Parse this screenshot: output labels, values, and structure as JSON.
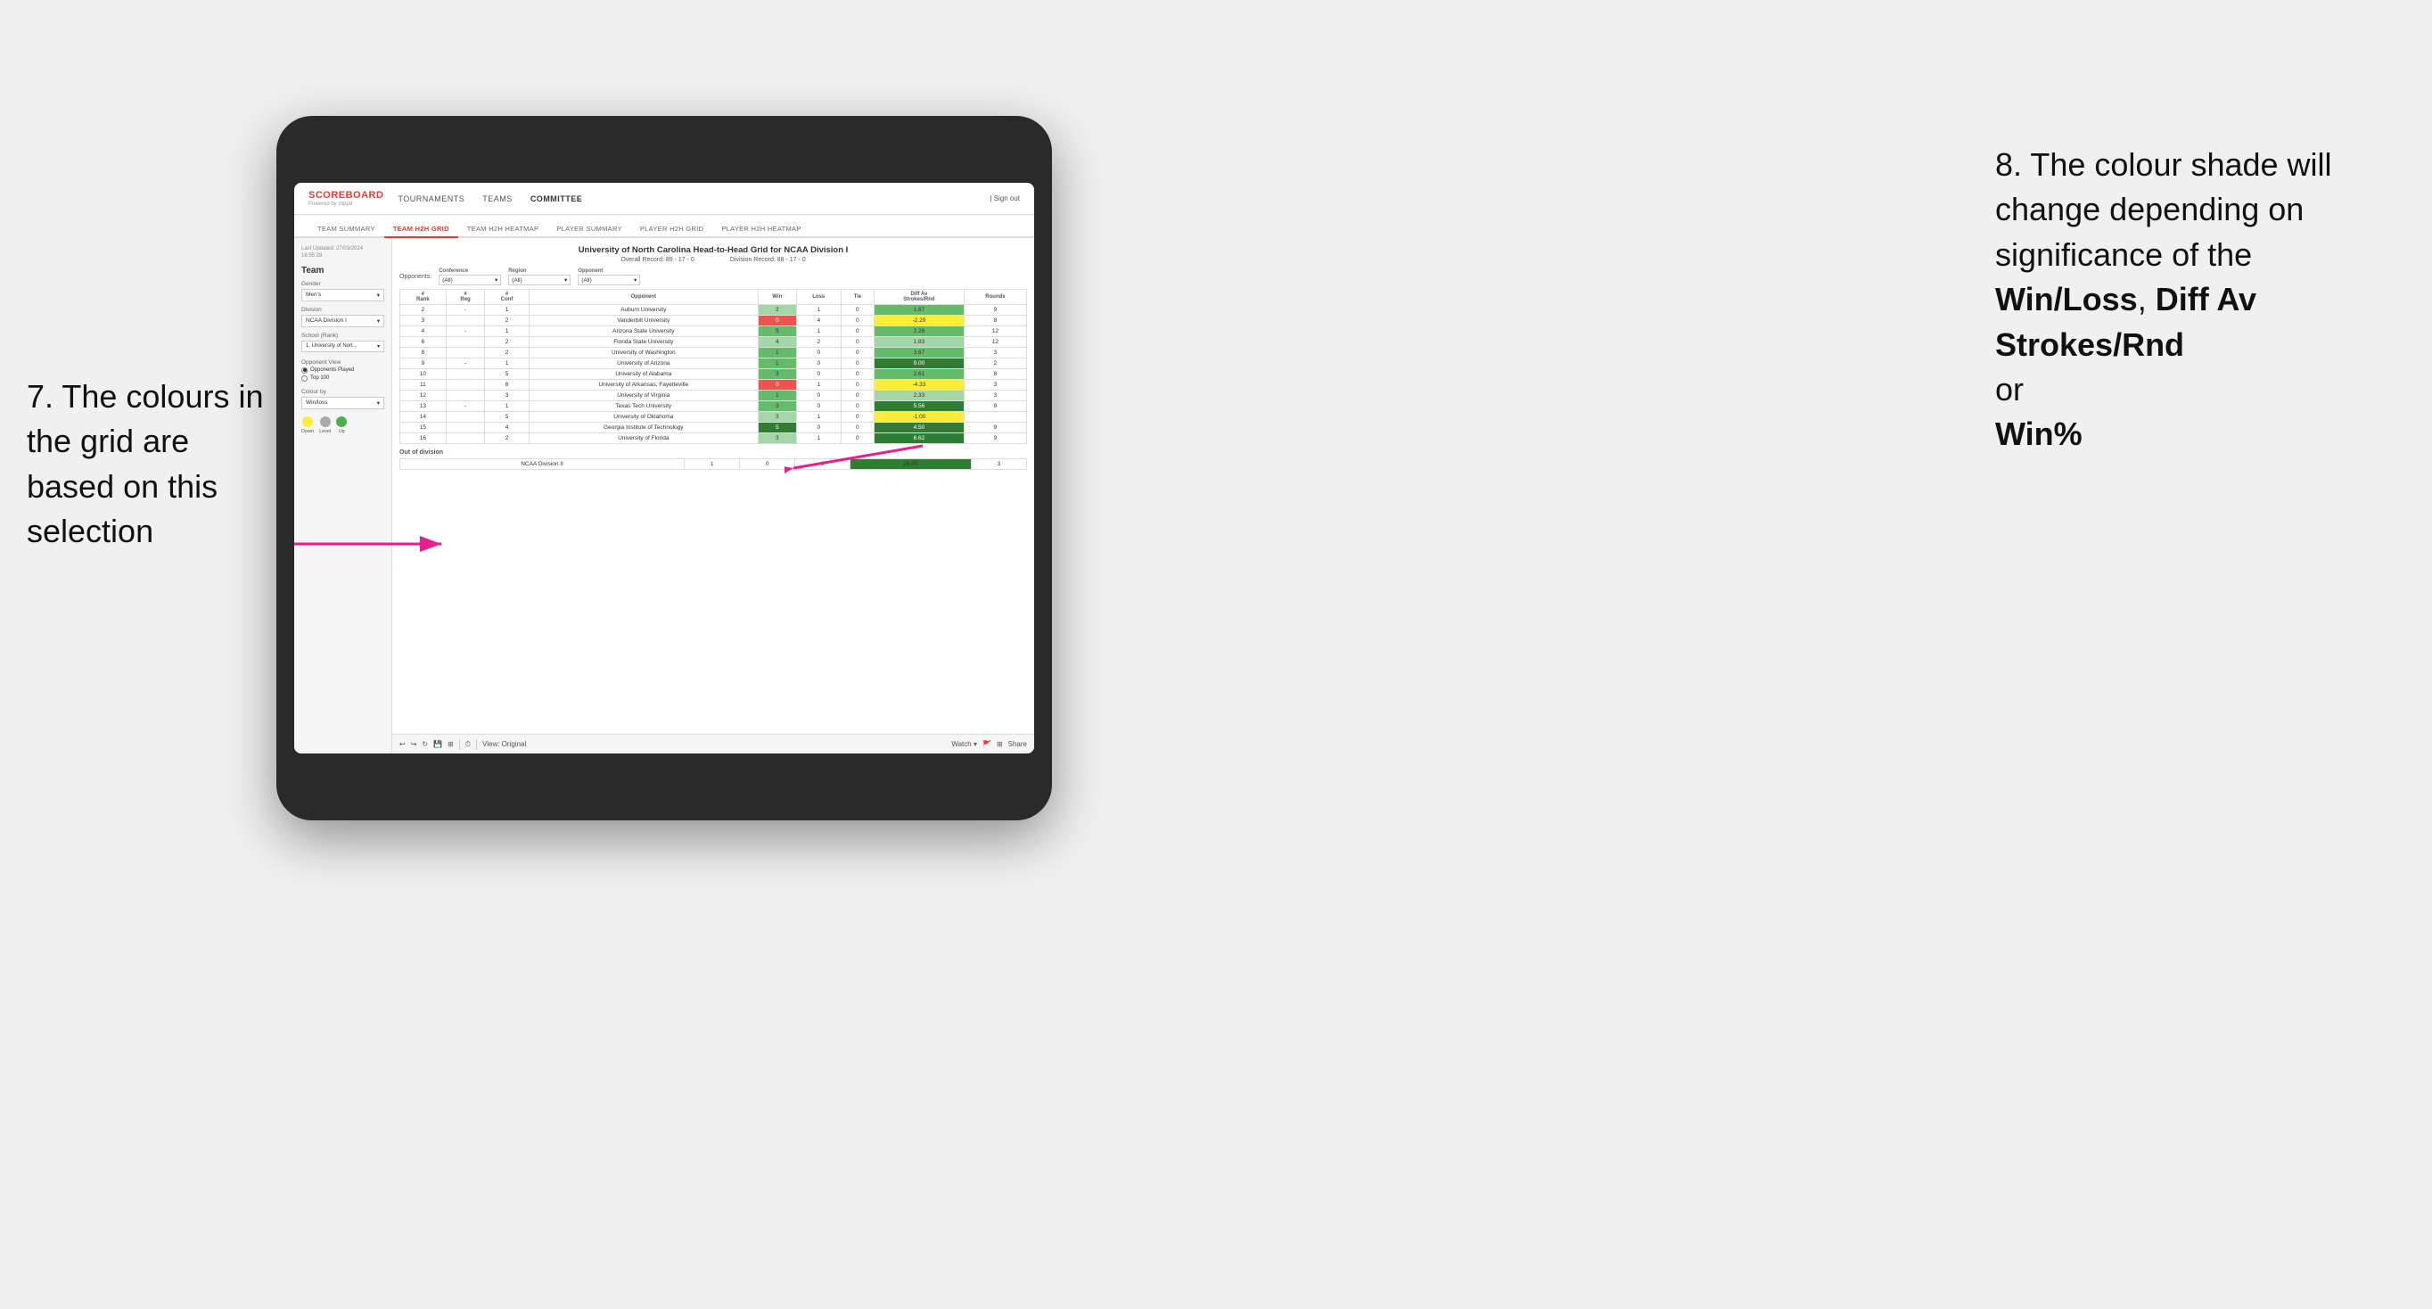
{
  "annotations": {
    "left_title": "7. The colours in the grid are based on this selection",
    "right_title": "8. The colour shade will change depending on significance of the",
    "right_bold1": "Win/Loss",
    "right_sep1": ", ",
    "right_bold2": "Diff Av Strokes/Rnd",
    "right_sep2": " or",
    "right_bold3": "Win%"
  },
  "nav": {
    "logo": "SCOREBOARD",
    "logo_sub": "Powered by clippd",
    "links": [
      "TOURNAMENTS",
      "TEAMS",
      "COMMITTEE"
    ],
    "sign_out": "| Sign out"
  },
  "sub_nav": {
    "items": [
      "TEAM SUMMARY",
      "TEAM H2H GRID",
      "TEAM H2H HEATMAP",
      "PLAYER SUMMARY",
      "PLAYER H2H GRID",
      "PLAYER H2H HEATMAP"
    ],
    "active": "TEAM H2H GRID"
  },
  "left_panel": {
    "last_updated_label": "Last Updated: 27/03/2024",
    "last_updated_time": "16:55:28",
    "team_label": "Team",
    "gender_label": "Gender",
    "gender_value": "Men's",
    "division_label": "Division",
    "division_value": "NCAA Division I",
    "school_label": "School (Rank)",
    "school_value": "1. University of Nort...",
    "opponent_view_label": "Opponent View",
    "radio1": "Opponents Played",
    "radio2": "Top 100",
    "colour_by_label": "Colour by",
    "colour_by_value": "Win/loss",
    "legend": [
      {
        "label": "Down",
        "color": "#ffeb3b"
      },
      {
        "label": "Level",
        "color": "#aaaaaa"
      },
      {
        "label": "Up",
        "color": "#4caf50"
      }
    ]
  },
  "grid": {
    "title": "University of North Carolina Head-to-Head Grid for NCAA Division I",
    "overall_record_label": "Overall Record:",
    "overall_record": "89 - 17 - 0",
    "division_record_label": "Division Record:",
    "division_record": "88 - 17 - 0",
    "filters": {
      "conference_label": "Conference",
      "conference_value": "(All)",
      "region_label": "Region",
      "region_value": "(All)",
      "opponent_label": "Opponent",
      "opponent_value": "(All)",
      "opponents_label": "Opponents:"
    },
    "columns": [
      "#\nRank",
      "#\nReg",
      "#\nConf",
      "Opponent",
      "Win",
      "Loss",
      "Tie",
      "Diff Av\nStrokes/Rnd",
      "Rounds"
    ],
    "rows": [
      {
        "rank": "2",
        "reg": "-",
        "conf": "1",
        "opponent": "Auburn University",
        "win": "2",
        "loss": "1",
        "tie": "0",
        "diff": "1.67",
        "rounds": "9",
        "win_color": "green-light",
        "diff_color": "green"
      },
      {
        "rank": "3",
        "reg": "",
        "conf": "2",
        "opponent": "Vanderbilt University",
        "win": "0",
        "loss": "4",
        "tie": "0",
        "diff": "-2.29",
        "rounds": "8",
        "win_color": "red",
        "diff_color": "yellow"
      },
      {
        "rank": "4",
        "reg": "-",
        "conf": "1",
        "opponent": "Arizona State University",
        "win": "5",
        "loss": "1",
        "tie": "0",
        "diff": "2.28",
        "rounds": "12",
        "win_color": "green",
        "diff_color": "green"
      },
      {
        "rank": "6",
        "reg": "",
        "conf": "2",
        "opponent": "Florida State University",
        "win": "4",
        "loss": "2",
        "tie": "0",
        "diff": "1.83",
        "rounds": "12",
        "win_color": "green-light",
        "diff_color": "green-light"
      },
      {
        "rank": "8",
        "reg": "",
        "conf": "2",
        "opponent": "University of Washington",
        "win": "1",
        "loss": "0",
        "tie": "0",
        "diff": "3.67",
        "rounds": "3",
        "win_color": "green",
        "diff_color": "green"
      },
      {
        "rank": "9",
        "reg": "-",
        "conf": "1",
        "opponent": "University of Arizona",
        "win": "1",
        "loss": "0",
        "tie": "0",
        "diff": "9.00",
        "rounds": "2",
        "win_color": "green",
        "diff_color": "green-dark"
      },
      {
        "rank": "10",
        "reg": "",
        "conf": "5",
        "opponent": "University of Alabama",
        "win": "3",
        "loss": "0",
        "tie": "0",
        "diff": "2.61",
        "rounds": "8",
        "win_color": "green",
        "diff_color": "green"
      },
      {
        "rank": "11",
        "reg": "",
        "conf": "6",
        "opponent": "University of Arkansas, Fayetteville",
        "win": "0",
        "loss": "1",
        "tie": "0",
        "diff": "-4.33",
        "rounds": "3",
        "win_color": "red",
        "diff_color": "yellow"
      },
      {
        "rank": "12",
        "reg": "",
        "conf": "3",
        "opponent": "University of Virginia",
        "win": "1",
        "loss": "0",
        "tie": "0",
        "diff": "2.33",
        "rounds": "3",
        "win_color": "green",
        "diff_color": "green-light"
      },
      {
        "rank": "13",
        "reg": "-",
        "conf": "1",
        "opponent": "Texas Tech University",
        "win": "3",
        "loss": "0",
        "tie": "0",
        "diff": "5.56",
        "rounds": "9",
        "win_color": "green",
        "diff_color": "green-dark"
      },
      {
        "rank": "14",
        "reg": "",
        "conf": "5",
        "opponent": "University of Oklahoma",
        "win": "3",
        "loss": "1",
        "tie": "0",
        "diff": "-1.00",
        "rounds": "",
        "win_color": "green-light",
        "diff_color": "yellow"
      },
      {
        "rank": "15",
        "reg": "",
        "conf": "4",
        "opponent": "Georgia Institute of Technology",
        "win": "5",
        "loss": "0",
        "tie": "0",
        "diff": "4.50",
        "rounds": "9",
        "win_color": "green-dark",
        "diff_color": "green-dark"
      },
      {
        "rank": "16",
        "reg": "",
        "conf": "2",
        "opponent": "University of Florida",
        "win": "3",
        "loss": "1",
        "tie": "0",
        "diff": "6.62",
        "rounds": "9",
        "win_color": "green-light",
        "diff_color": "green-dark"
      }
    ],
    "out_of_division_label": "Out of division",
    "out_of_division_row": {
      "label": "NCAA Division II",
      "win": "1",
      "loss": "0",
      "tie": "0",
      "diff": "26.00",
      "rounds": "3",
      "diff_color": "green-dark"
    }
  },
  "toolbar": {
    "view_label": "View: Original",
    "watch_label": "Watch ▾",
    "share_label": "Share"
  }
}
